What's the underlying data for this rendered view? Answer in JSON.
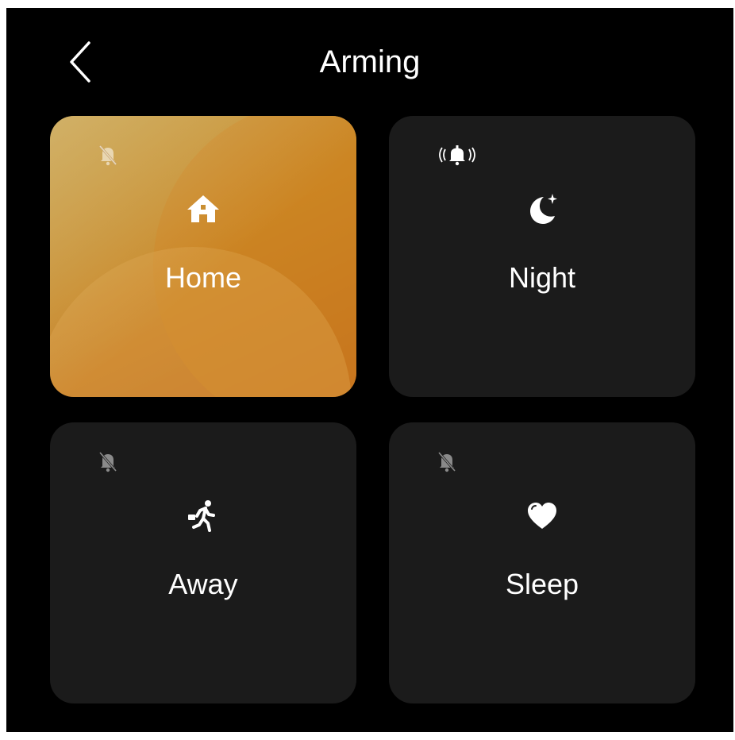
{
  "header": {
    "title": "Arming"
  },
  "modes": [
    {
      "label": "Home",
      "icon": "home-icon",
      "status_icon": "bell-off-icon",
      "selected": true
    },
    {
      "label": "Night",
      "icon": "moon-star-icon",
      "status_icon": "bell-ringing-icon",
      "selected": false
    },
    {
      "label": "Away",
      "icon": "running-person-icon",
      "status_icon": "bell-off-icon",
      "selected": false
    },
    {
      "label": "Sleep",
      "icon": "heart-icon",
      "status_icon": "bell-off-icon",
      "selected": false
    }
  ],
  "colors": {
    "background": "#000000",
    "tile": "#1b1b1b",
    "active_tile_gradient": [
      "#c99a3a",
      "#c0661f"
    ],
    "text": "#ffffff"
  }
}
